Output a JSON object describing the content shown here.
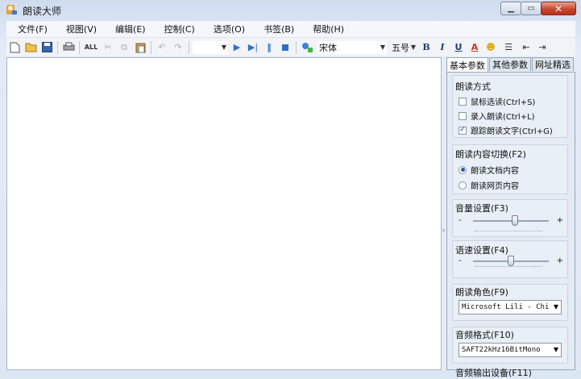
{
  "window": {
    "title": "朗读大师",
    "min_label": "▁",
    "max_label": "▭",
    "close_label": "✕"
  },
  "menu": [
    "文件(F)",
    "视图(V)",
    "编辑(E)",
    "控制(C)",
    "选项(O)",
    "书签(B)",
    "帮助(H)"
  ],
  "toolbar": {
    "all_label": "ALL",
    "font_name": "宋体",
    "font_size": "五号",
    "bold": "B",
    "italic": "I",
    "underline": "U",
    "font_color": "A",
    "emoji": "☻",
    "align": "☰",
    "indent_dec": "⇤",
    "indent_inc": "⇥"
  },
  "tabs": [
    "基本参数",
    "其他参数",
    "网址精选"
  ],
  "read_mode": {
    "title": "朗读方式",
    "options": [
      {
        "label": "鼠标选读(Ctrl+S)",
        "checked": false
      },
      {
        "label": "录入朗读(Ctrl+L)",
        "checked": false
      },
      {
        "label": "跟踪朗读文字(Ctrl+G)",
        "checked": true
      }
    ]
  },
  "content_switch": {
    "title": "朗读内容切换(F2)",
    "options": [
      {
        "label": "朗读文档内容",
        "selected": true
      },
      {
        "label": "朗读网页内容",
        "selected": false
      }
    ]
  },
  "volume": {
    "title": "音量设置(F3)",
    "minus": "-",
    "plus": "+",
    "level": 0.55
  },
  "speed": {
    "title": "语速设置(F4)",
    "minus": "-",
    "plus": "+",
    "level": 0.5
  },
  "voice": {
    "title": "朗读角色(F9)",
    "value": "Microsoft Lili - Chi"
  },
  "audio_format": {
    "title": "音频格式(F10)",
    "value": "SAFT22kHz16BitMono"
  },
  "audio_output": {
    "title": "音频输出设备(F11)"
  }
}
